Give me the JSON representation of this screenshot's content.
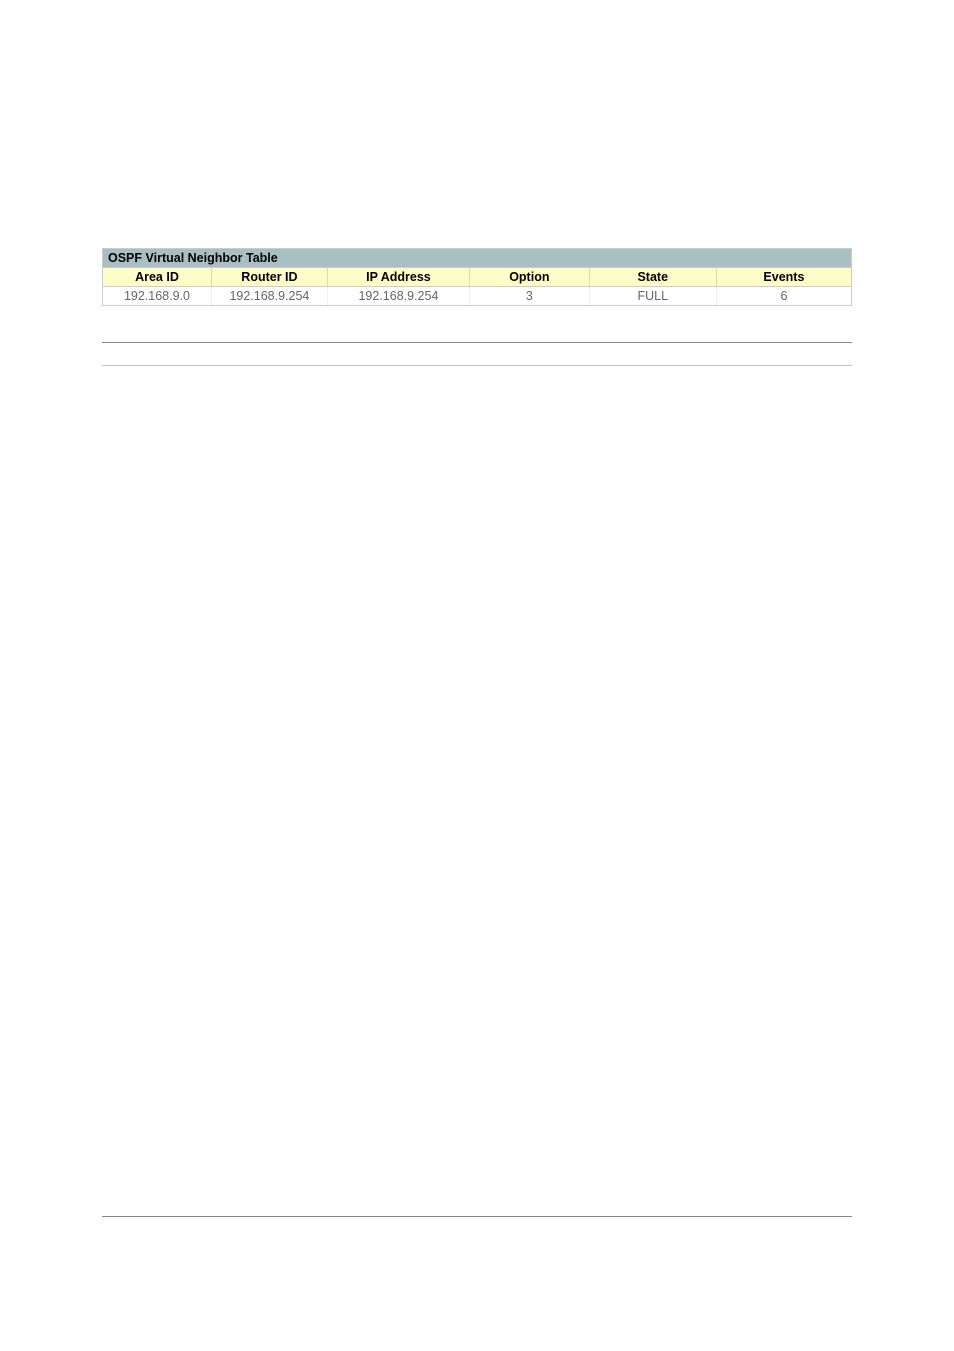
{
  "table": {
    "title": "OSPF Virtual Neighbor Table",
    "headers": {
      "area_id": "Area ID",
      "router_id": "Router ID",
      "ip_address": "IP Address",
      "option": "Option",
      "state": "State",
      "events": "Events"
    },
    "rows": [
      {
        "area_id": "192.168.9.0",
        "router_id": "192.168.9.254",
        "ip_address": "192.168.9.254",
        "option": "3",
        "state": "FULL",
        "events": "6"
      }
    ]
  }
}
